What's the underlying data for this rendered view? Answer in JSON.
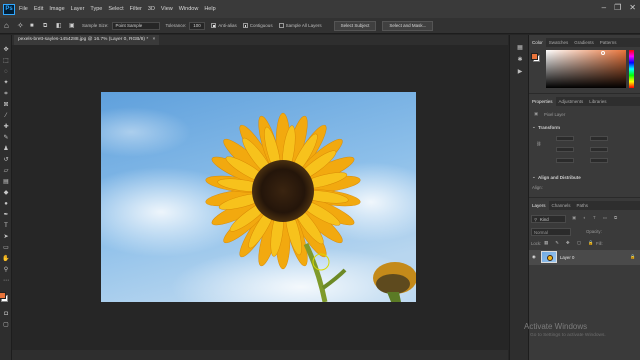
{
  "app": {
    "menu": [
      "File",
      "Edit",
      "Image",
      "Layer",
      "Type",
      "Select",
      "Filter",
      "3D",
      "View",
      "Window",
      "Help"
    ]
  },
  "options": {
    "sample_size_label": "Sample Size:",
    "sample_size_value": "Point Sample",
    "tolerance_label": "Tolerance:",
    "tolerance_value": "100",
    "anti_alias_label": "Anti-alias",
    "anti_alias_checked": true,
    "contiguous_label": "Contiguous",
    "contiguous_checked": true,
    "sample_all_layers_label": "Sample All Layers",
    "sample_all_layers_checked": false,
    "select_subject_label": "Select Subject",
    "select_and_mask_label": "Select and Mask..."
  },
  "document": {
    "tab_title": "pexels-brett-sayles-1454288.jpg @ 16.7% (Layer 0, RGB/8) *"
  },
  "panels": {
    "color_tabs": [
      "Color",
      "Swatches",
      "Gradients",
      "Patterns"
    ],
    "properties_tabs": [
      "Properties",
      "Adjustments",
      "Libraries"
    ],
    "pixel_layer_label": "Pixel Layer",
    "transform_title": "Transform",
    "align_title": "Align and Distribute",
    "align_sub": "Align:",
    "layers_tabs": [
      "Layers",
      "Channels",
      "Paths"
    ],
    "kind_label": "Kind",
    "blend_mode": "Normal",
    "opacity_label": "Opacity:",
    "lock_label": "Lock:",
    "fill_label": "Fill:",
    "layer_name": "Layer 0"
  },
  "overlay": {
    "watermark_title": "Activate Windows",
    "watermark_sub": "Go to Settings to activate Windows."
  },
  "colors": {
    "foreground": "#e8743b",
    "background": "#ffffff",
    "accent": "#31a8ff"
  },
  "icons": {
    "tools": [
      "move-icon",
      "marquee-icon",
      "lasso-icon",
      "magic-wand-icon",
      "crop-icon",
      "frame-icon",
      "eyedropper-icon",
      "healing-brush-icon",
      "brush-icon",
      "clone-stamp-icon",
      "history-brush-icon",
      "eraser-icon",
      "gradient-icon",
      "blur-icon",
      "dodge-icon",
      "pen-icon",
      "type-icon",
      "path-selection-icon",
      "rectangle-icon",
      "hand-icon",
      "zoom-icon",
      "more-tools-icon"
    ]
  }
}
